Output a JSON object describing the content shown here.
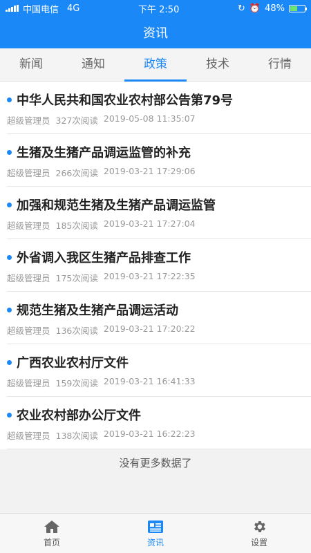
{
  "status": {
    "carrier": "中国电信",
    "network": "4G",
    "time": "下午 2:50",
    "battery": "48%",
    "battery_level": 0.48
  },
  "header": {
    "title": "资讯"
  },
  "tabs": [
    {
      "label": "新闻"
    },
    {
      "label": "通知"
    },
    {
      "label": "政策"
    },
    {
      "label": "技术"
    },
    {
      "label": "行情"
    }
  ],
  "active_tab": "政策",
  "articles": [
    {
      "title": "中华人民共和国农业农村部公告第79号",
      "author": "超级管理员",
      "reads": "327次阅读",
      "date": "2019-05-08 11:35:07"
    },
    {
      "title": "生猪及生猪产品调运监管的补充",
      "author": "超级管理员",
      "reads": "266次阅读",
      "date": "2019-03-21 17:29:06"
    },
    {
      "title": "加强和规范生猪及生猪产品调运监管",
      "author": "超级管理员",
      "reads": "185次阅读",
      "date": "2019-03-21 17:27:04"
    },
    {
      "title": "外省调入我区生猪产品排查工作",
      "author": "超级管理员",
      "reads": "175次阅读",
      "date": "2019-03-21 17:22:35"
    },
    {
      "title": "规范生猪及生猪产品调运活动",
      "author": "超级管理员",
      "reads": "136次阅读",
      "date": "2019-03-21 17:20:22"
    },
    {
      "title": "广西农业农村厅文件",
      "author": "超级管理员",
      "reads": "159次阅读",
      "date": "2019-03-21 16:41:33"
    },
    {
      "title": "农业农村部办公厅文件",
      "author": "超级管理员",
      "reads": "138次阅读",
      "date": "2019-03-21 16:22:23"
    }
  ],
  "list_footer": "没有更多数据了",
  "bottom_nav": [
    {
      "label": "首页",
      "icon": "home-icon"
    },
    {
      "label": "资讯",
      "icon": "news-icon"
    },
    {
      "label": "设置",
      "icon": "gear-icon"
    }
  ],
  "colors": {
    "accent": "#1a88f7"
  }
}
